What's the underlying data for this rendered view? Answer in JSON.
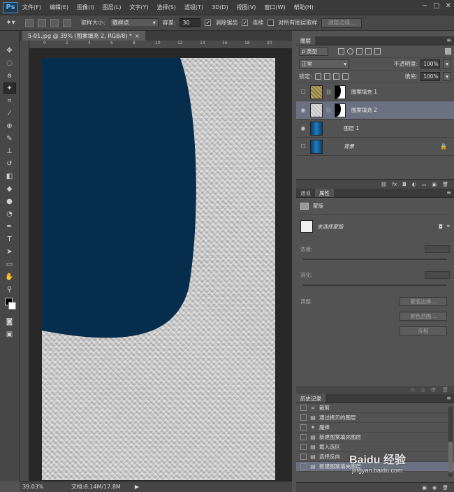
{
  "app": {
    "logo": "Ps"
  },
  "menu": [
    "文件(F)",
    "编辑(E)",
    "图像(I)",
    "图层(L)",
    "文字(Y)",
    "选择(S)",
    "滤镜(T)",
    "3D(D)",
    "视图(V)",
    "窗口(W)",
    "帮助(H)"
  ],
  "window_controls": [
    "−",
    "□",
    "✕"
  ],
  "options": {
    "sample_size_label": "取样大小:",
    "sample_size_value": "取样点",
    "tolerance_label": "容差:",
    "tolerance_value": "30",
    "antialias_label": "消除锯齿",
    "contiguous_label": "连续",
    "all_layers_label": "对所有图层取样",
    "refine_edge_label": "调整边缘..."
  },
  "document": {
    "tab_title": "5-01.jpg @ 39% (图案填充 2, RGB/8) *",
    "close": "×",
    "ruler_ticks": [
      "0",
      "2",
      "4",
      "6",
      "8",
      "10",
      "12",
      "14",
      "16",
      "18",
      "20"
    ],
    "zoom": "39.03%",
    "doc_info": "文档:8.14M/17.8M",
    "status_arrow": "▶",
    "shape_color": "#062d4c",
    "texture_color": "#c9c9c9"
  },
  "layers_panel": {
    "tab": "图层",
    "menu_icon": "≡",
    "filter_label": "ρ 类型",
    "blend_mode": "正常",
    "opacity_label": "不透明度:",
    "opacity_value": "100%",
    "lock_label": "锁定:",
    "fill_label": "填充:",
    "fill_value": "100%",
    "layers": [
      {
        "name": "图案填充 1",
        "visible": false,
        "selected": false,
        "thumb": "pattern-gold",
        "has_mask": true
      },
      {
        "name": "图案填充 2",
        "visible": true,
        "selected": true,
        "thumb": "pattern-gray",
        "has_mask": true
      },
      {
        "name": "图层 1",
        "visible": true,
        "selected": false,
        "thumb": "blue-gradient",
        "has_mask": false
      },
      {
        "name": "背景",
        "visible": false,
        "selected": false,
        "thumb": "blue-gradient",
        "has_mask": false,
        "locked": true
      }
    ],
    "footer_icons": [
      "link-icon",
      "fx-icon",
      "mask-icon",
      "adjustment-icon",
      "folder-icon",
      "new-layer-icon",
      "trash-icon"
    ],
    "footer_glyphs": [
      "⛓",
      "fx",
      "◘",
      "◐",
      "▭",
      "▣",
      "🗑"
    ]
  },
  "properties_panel": {
    "tabs": [
      "通道",
      "属性"
    ],
    "mask_title": "蒙版",
    "no_mask": "未选择蒙版",
    "density_label": "浓度:",
    "feather_label": "羽化:",
    "refine_label": "调整:",
    "mask_edge_button": "蒙版边缘...",
    "color_range_button": "颜色范围...",
    "invert_button": "反相",
    "footer_glyphs": [
      "⊙",
      "◎",
      "👁",
      "🗑"
    ]
  },
  "history_panel": {
    "tab": "历史记录",
    "items": [
      {
        "label": "裁剪",
        "icon": "crop-icon",
        "glyph": "⌗",
        "selected": false
      },
      {
        "label": "通过拷贝的图层",
        "icon": "document-icon",
        "glyph": "▤",
        "selected": false
      },
      {
        "label": "魔棒",
        "icon": "magic-wand-icon",
        "glyph": "✦",
        "selected": false
      },
      {
        "label": "新建图案填充图层",
        "icon": "document-icon",
        "glyph": "▤",
        "selected": false
      },
      {
        "label": "载入选区",
        "icon": "document-icon",
        "glyph": "▤",
        "selected": false
      },
      {
        "label": "选择反向",
        "icon": "document-icon",
        "glyph": "▤",
        "selected": false
      },
      {
        "label": "新建图案填充图层",
        "icon": "document-icon",
        "glyph": "▤",
        "selected": true
      }
    ],
    "footer_glyphs": [
      "▣",
      "◉",
      "🗑"
    ]
  },
  "watermark": {
    "logo": "Baidu 经验",
    "sub": "jingyan.baidu.com"
  }
}
